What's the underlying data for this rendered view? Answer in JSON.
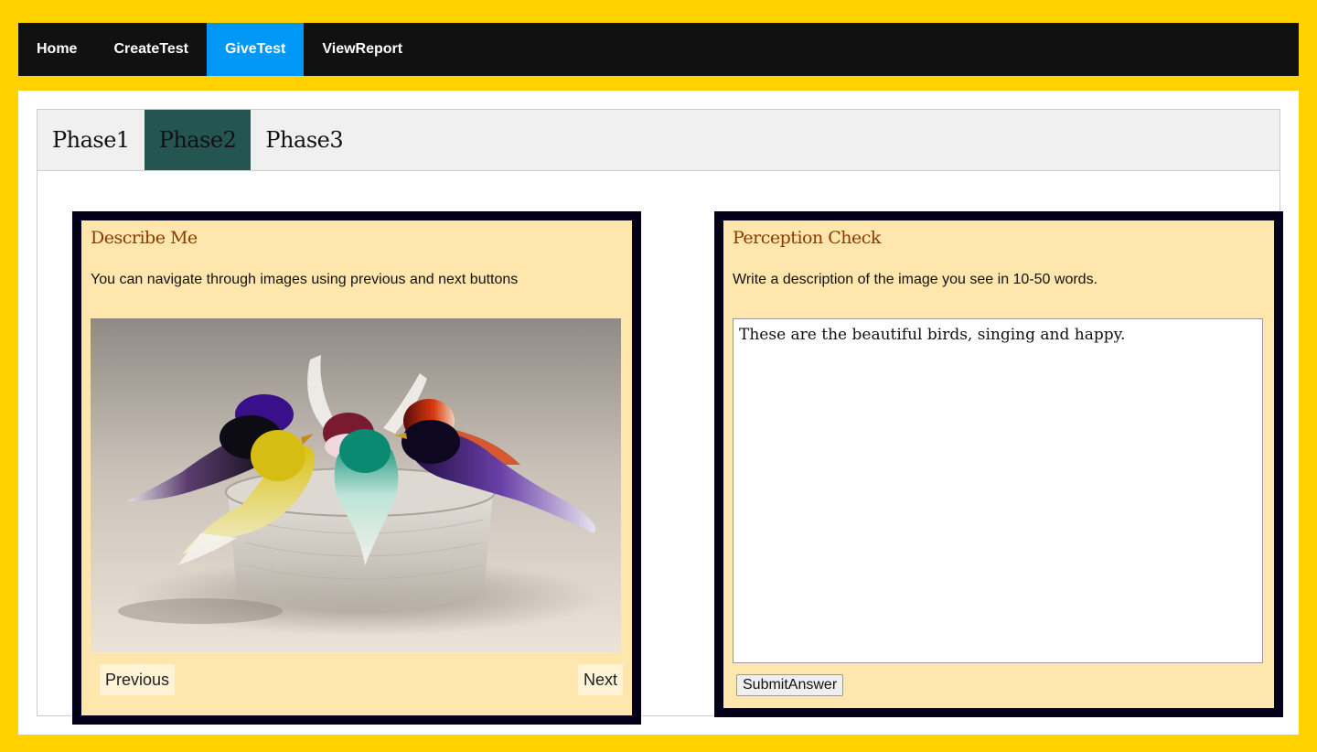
{
  "nav": {
    "items": [
      {
        "label": "Home"
      },
      {
        "label": "CreateTest"
      },
      {
        "label": "GiveTest"
      },
      {
        "label": "ViewReport"
      }
    ],
    "active_index": 2
  },
  "tabs": {
    "items": [
      {
        "label": "Phase1"
      },
      {
        "label": "Phase2"
      },
      {
        "label": "Phase3"
      }
    ],
    "active_index": 1
  },
  "describe_panel": {
    "title": "Describe Me",
    "description": "You can navigate through images using previous and next buttons",
    "image_icon": "glass-birds-photo",
    "previous_label": "Previous",
    "next_label": "Next"
  },
  "perception_panel": {
    "title": "Perception Check",
    "description": "Write a description of the image you see in 10-50 words.",
    "answer_value": "These are the beautiful birds, singing and happy.",
    "submit_label": "SubmitAnswer"
  },
  "colors": {
    "page_background": "#FFD200",
    "navbar_background": "#111111",
    "nav_active": "#0097F6",
    "tab_active": "#245550",
    "panel_background": "#FFE6AD",
    "panel_border": "#03001A",
    "panel_title": "#8B3A00"
  }
}
